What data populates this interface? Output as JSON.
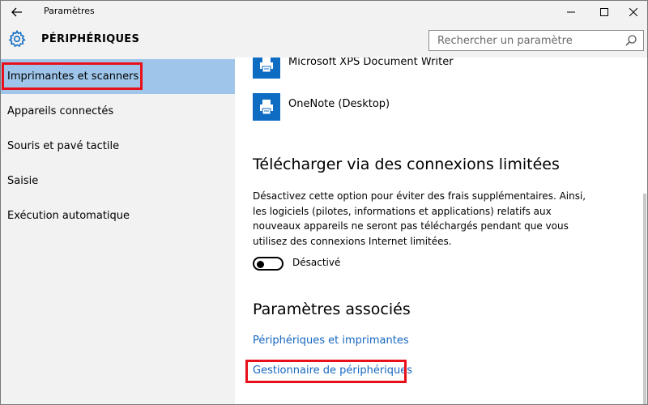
{
  "window": {
    "title": "Paramètres"
  },
  "header": {
    "page_title": "PÉRIPHÉRIQUES",
    "search_placeholder": "Rechercher un paramètre"
  },
  "sidebar": {
    "items": [
      {
        "label": "Imprimantes et scanners",
        "selected": true
      },
      {
        "label": "Appareils connectés"
      },
      {
        "label": "Souris et pavé tactile"
      },
      {
        "label": "Saisie"
      },
      {
        "label": "Exécution automatique"
      }
    ]
  },
  "main": {
    "devices": [
      {
        "label": "Microsoft XPS Document Writer",
        "icon": "printer-icon"
      },
      {
        "label": "OneNote (Desktop)",
        "icon": "printer-icon"
      }
    ],
    "metered_section": {
      "title": "Télécharger via des connexions limitées",
      "description": "Désactivez cette option pour éviter des frais supplémentaires. Ainsi, les logiciels (pilotes, informations et applications) relatifs aux nouveaux appareils ne seront pas téléchargés pendant que vous utilisez des connexions Internet limitées.",
      "toggle_state": "Désactivé",
      "toggle_on": false
    },
    "related_section": {
      "title": "Paramètres associés",
      "links": [
        "Périphériques et imprimantes",
        "Gestionnaire de périphériques"
      ]
    }
  },
  "colors": {
    "accent": "#0f6cc3",
    "selection": "#9fc6ea",
    "highlight": "#e8101a",
    "link": "#1567c0",
    "chrome": "#f2f2f2"
  }
}
